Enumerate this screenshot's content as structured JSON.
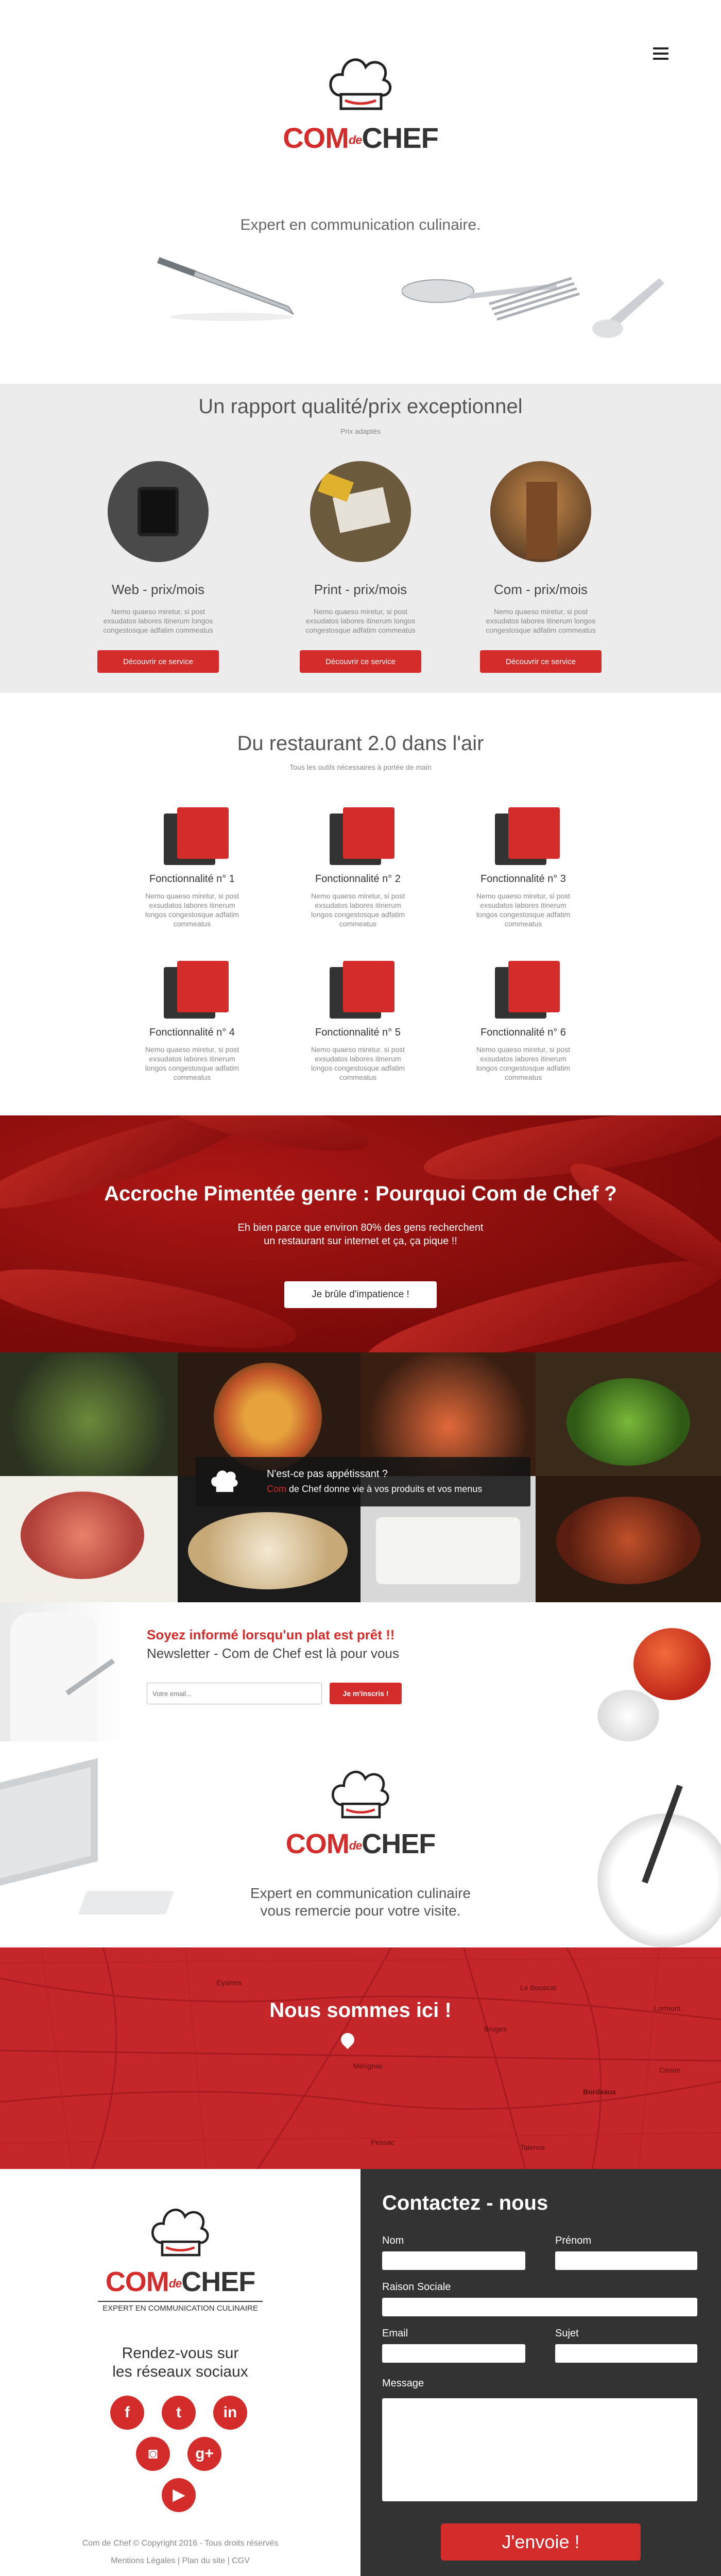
{
  "header": {
    "menu_icon": "hamburger-menu-icon",
    "logo": {
      "word1": "COM",
      "word_de": "de",
      "word2": "CHEF"
    },
    "tagline": "Expert en communication culinaire."
  },
  "prices": {
    "title": "Un rapport qualité/prix exceptionnel",
    "subtitle": "Prix adaptés",
    "services": [
      {
        "title": "Web - prix/mois",
        "text": "Nemo quaeso miretur, si post exsudatos labores itinerum longos congestosque adfatim commeatus",
        "button": "Découvrir ce service"
      },
      {
        "title": "Print - prix/mois",
        "text": "Nemo quaeso miretur, si post exsudatos labores itinerum longos congestosque adfatim commeatus",
        "button": "Découvrir ce service"
      },
      {
        "title": "Com - prix/mois",
        "text": "Nemo quaeso miretur, si post exsudatos labores itinerum longos congestosque adfatim commeatus",
        "button": "Découvrir ce service"
      }
    ]
  },
  "features": {
    "title": "Du restaurant 2.0 dans l'air",
    "subtitle": "Tous les outils nécessaires à portée de main",
    "items": [
      {
        "title": "Fonctionnalité n° 1",
        "text": "Nemo quaeso miretur, si post exsudatos labores itinerum longos congestosque adfatim commeatus"
      },
      {
        "title": "Fonctionnalité n° 2",
        "text": "Nemo quaeso miretur, si post exsudatos labores itinerum longos congestosque adfatim commeatus"
      },
      {
        "title": "Fonctionnalité n° 3",
        "text": "Nemo quaeso miretur, si post exsudatos labores itinerum longos congestosque adfatim commeatus"
      },
      {
        "title": "Fonctionnalité n° 4",
        "text": "Nemo quaeso miretur, si post exsudatos labores itinerum longos congestosque adfatim commeatus"
      },
      {
        "title": "Fonctionnalité n° 5",
        "text": "Nemo quaeso miretur, si post exsudatos labores itinerum longos congestosque adfatim commeatus"
      },
      {
        "title": "Fonctionnalité n° 6",
        "text": "Nemo quaeso miretur, si post exsudatos labores itinerum longos congestosque adfatim commeatus"
      }
    ]
  },
  "hero": {
    "title": "Accroche Pimentée genre : Pourquoi Com de Chef ?",
    "line1": "Eh bien parce que environ 80% des gens recherchent",
    "line2": "un restaurant sur internet et ça, ça pique !!",
    "button": "Je brûle d'impatience !"
  },
  "food": {
    "overlay_title": "N'est-ce pas appétissant ?",
    "overlay_brand": "Com",
    "overlay_text": " de Chef  donne vie à vos produits et vos menus"
  },
  "newsletter": {
    "title": "Soyez informé lorsqu'un plat est prêt !!",
    "subtitle": "Newsletter - Com de Chef est là pour vous",
    "placeholder": "Votre email...",
    "button": "Je m'inscris !"
  },
  "thanks": {
    "line1": "Expert en communication culinaire",
    "line2": "vous remercie pour votre visite."
  },
  "map": {
    "title": "Nous sommes ici !",
    "labels": [
      "Mérignac",
      "Bordeaux",
      "Le Bouscat",
      "Bruges",
      "Eysines",
      "Pessac",
      "Talence",
      "Cenon",
      "Lormont"
    ]
  },
  "footer": {
    "logo_tag": "EXPERT EN COMMUNICATION CULINAIRE",
    "social_title_1": "Rendez-vous sur",
    "social_title_2": "les réseaux sociaux",
    "social": [
      {
        "name": "facebook-icon",
        "glyph": "f"
      },
      {
        "name": "twitter-icon",
        "glyph": "t"
      },
      {
        "name": "linkedin-icon",
        "glyph": "in"
      },
      {
        "name": "instagram-icon",
        "glyph": "◙"
      },
      {
        "name": "google-plus-icon",
        "glyph": "g+"
      },
      {
        "name": "youtube-icon",
        "glyph": "▶"
      }
    ],
    "copyright": "Com de Chef © Copyright 2016 - Tous droits réservés",
    "legal": "Mentions Légales | Plan du site | CGV"
  },
  "contact": {
    "title": "Contactez - nous",
    "nom": "Nom",
    "prenom": "Prénom",
    "raison": "Raison Sociale",
    "email": "Email",
    "sujet": "Sujet",
    "message": "Message",
    "button": "J'envoie !"
  }
}
